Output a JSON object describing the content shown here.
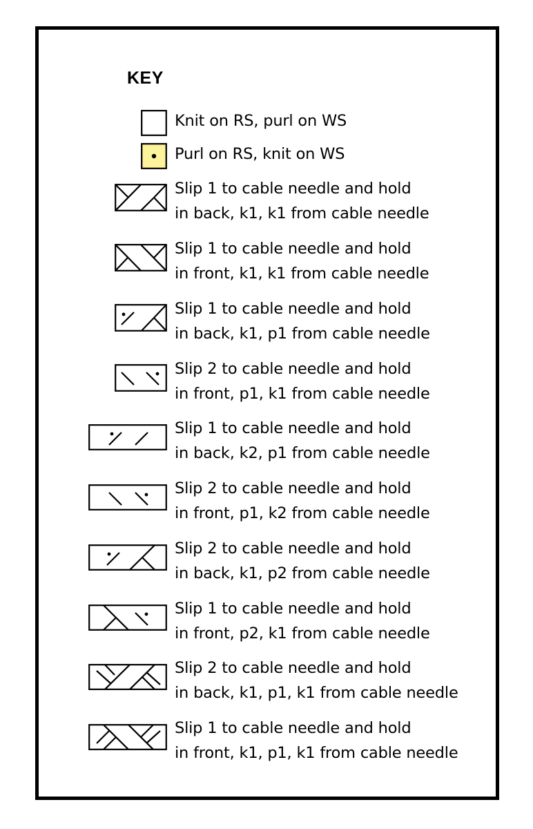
{
  "key": {
    "title": "KEY",
    "items": [
      {
        "symbol": "knit-stitch-box",
        "lines": [
          "Knit on RS, purl on WS"
        ]
      },
      {
        "symbol": "purl-stitch-dot-box",
        "fill_color": "#fdf39a",
        "lines": [
          "Purl on RS, knit on WS"
        ]
      },
      {
        "symbol": "1-over-1-right-cross-icon",
        "lines": [
          "Slip 1 to cable needle and hold",
          "in back, k1, k1 from cable needle"
        ]
      },
      {
        "symbol": "1-over-1-left-cross-icon",
        "lines": [
          "Slip 1 to cable needle and hold",
          "in front, k1, k1 from cable needle"
        ]
      },
      {
        "symbol": "1-over-1-right-purl-cross-icon",
        "lines": [
          "Slip 1 to cable needle and hold",
          "in back, k1, p1 from cable needle"
        ]
      },
      {
        "symbol": "1-over-1-left-purl-cross-icon",
        "lines": [
          "Slip 2 to cable needle and hold",
          "in front, p1, k1 from cable needle"
        ]
      },
      {
        "symbol": "2-over-1-right-purl-cross-icon",
        "lines": [
          "Slip 1 to cable needle and hold",
          "in back, k2, p1 from cable needle"
        ]
      },
      {
        "symbol": "2-over-1-left-purl-cross-icon",
        "lines": [
          "Slip 2 to cable needle and hold",
          "in front, p1, k2 from cable needle"
        ]
      },
      {
        "symbol": "1-over-2-right-purl-cross-icon",
        "lines": [
          "Slip 2 to cable needle and hold",
          "in back, k1, p2 from cable needle"
        ]
      },
      {
        "symbol": "1-over-2-left-purl-cross-icon",
        "lines": [
          "Slip 1 to cable needle and hold",
          "in front, p2, k1 from cable needle"
        ]
      },
      {
        "symbol": "1-1-1-right-cross-icon",
        "lines": [
          "Slip 2 to cable needle and hold",
          "in back, k1, p1, k1 from cable needle"
        ]
      },
      {
        "symbol": "1-1-1-left-cross-icon",
        "lines": [
          "Slip 1 to cable needle and hold",
          "in front, k1, p1, k1 from cable needle"
        ]
      }
    ]
  }
}
